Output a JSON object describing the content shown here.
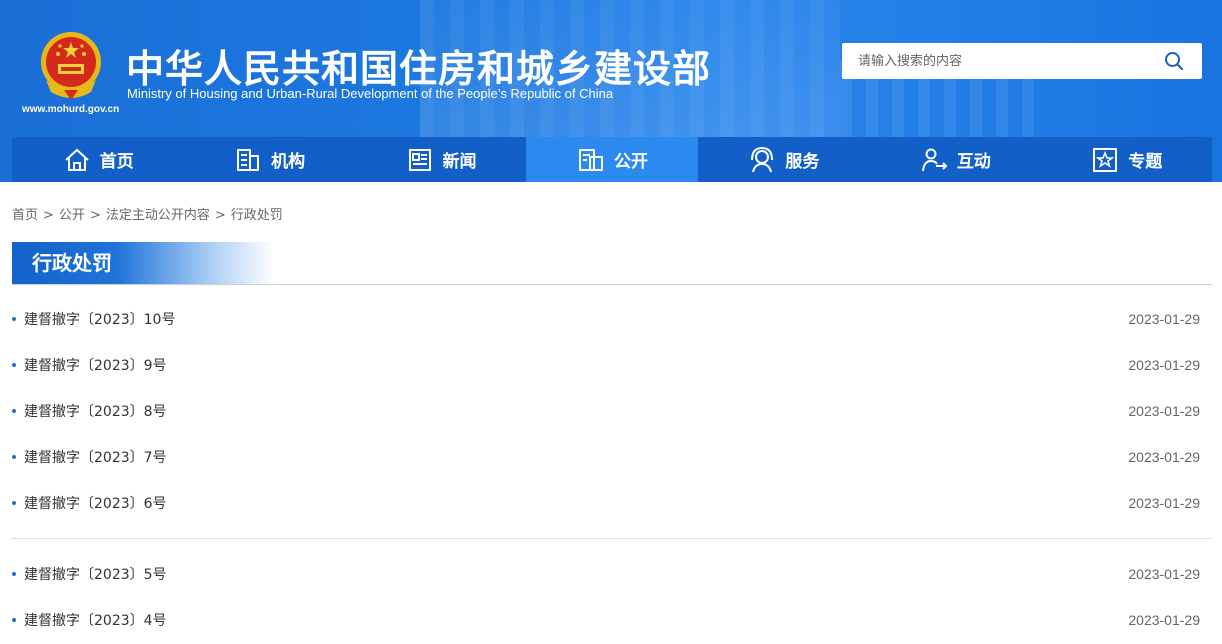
{
  "header": {
    "title": "中华人民共和国住房和城乡建设部",
    "subtitle": "Ministry of Housing and Urban-Rural Development of the People’s Republic of China",
    "url": "www.mohurd.gov.cn",
    "search_placeholder": "请输入搜索的内容"
  },
  "nav": [
    {
      "label": "首页",
      "icon": "home-icon"
    },
    {
      "label": "机构",
      "icon": "building-icon"
    },
    {
      "label": "新闻",
      "icon": "news-icon"
    },
    {
      "label": "公开",
      "icon": "public-icon",
      "active": true
    },
    {
      "label": "服务",
      "icon": "service-icon"
    },
    {
      "label": "互动",
      "icon": "interact-icon"
    },
    {
      "label": "专题",
      "icon": "special-icon"
    }
  ],
  "breadcrumb": [
    "首页",
    "公开",
    "法定主动公开内容",
    "行政处罚"
  ],
  "section_title": "行政处罚",
  "list_groups": [
    [
      {
        "title": "建督撤字〔2023〕10号",
        "date": "2023-01-29"
      },
      {
        "title": "建督撤字〔2023〕9号",
        "date": "2023-01-29"
      },
      {
        "title": "建督撤字〔2023〕8号",
        "date": "2023-01-29"
      },
      {
        "title": "建督撤字〔2023〕7号",
        "date": "2023-01-29"
      },
      {
        "title": "建督撤字〔2023〕6号",
        "date": "2023-01-29"
      }
    ],
    [
      {
        "title": "建督撤字〔2023〕5号",
        "date": "2023-01-29"
      },
      {
        "title": "建督撤字〔2023〕4号",
        "date": "2023-01-29"
      }
    ]
  ],
  "colors": {
    "header_blue": "#1a74e0",
    "nav_blue": "#1260c7",
    "nav_active": "#2a8af0",
    "bullet": "#1e6fd4"
  }
}
